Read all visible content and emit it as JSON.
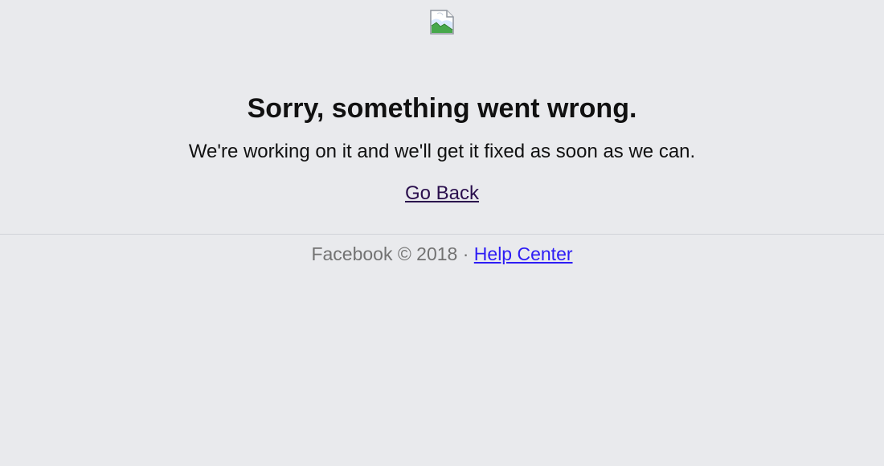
{
  "header": {
    "image_icon": "broken-image-icon"
  },
  "error": {
    "title": "Sorry, something went wrong.",
    "message": "We're working on it and we'll get it fixed as soon as we can.",
    "go_back_label": "Go Back"
  },
  "footer": {
    "brand_text": "Facebook © 2018 · ",
    "help_center_label": "Help Center"
  },
  "colors": {
    "background": "#e9eaed",
    "text": "#111111",
    "muted_text": "#727272",
    "visited_link": "#2a0f4d",
    "link": "#2d1cf5"
  }
}
